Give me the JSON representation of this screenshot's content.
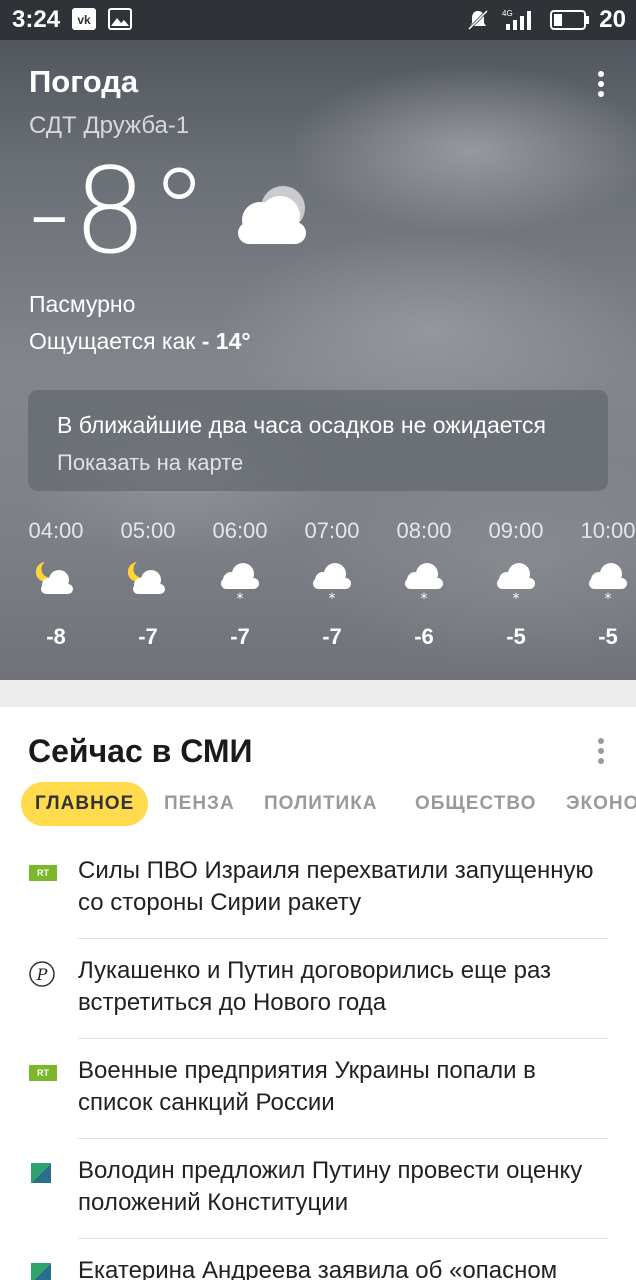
{
  "status_bar": {
    "time": "3:24",
    "network": "4G",
    "battery": "20"
  },
  "weather": {
    "title": "Погода",
    "location": "СДТ Дружба-1",
    "temperature": "-8°",
    "condition": "Пасмурно",
    "feels_like_label": "Ощущается как",
    "feels_like_value": "- 14°",
    "precip_text": "В ближайшие два часа осадков не ожидается",
    "precip_link": "Показать на карте",
    "hourly": [
      {
        "time": "04:00",
        "icon": "night-partly-cloudy-icon",
        "temp": "-8"
      },
      {
        "time": "05:00",
        "icon": "night-partly-cloudy-icon",
        "temp": "-7"
      },
      {
        "time": "06:00",
        "icon": "snow-cloud-icon",
        "temp": "-7"
      },
      {
        "time": "07:00",
        "icon": "snow-cloud-icon",
        "temp": "-7"
      },
      {
        "time": "08:00",
        "icon": "snow-cloud-icon",
        "temp": "-6"
      },
      {
        "time": "09:00",
        "icon": "snow-cloud-icon",
        "temp": "-5"
      },
      {
        "time": "10:00",
        "icon": "snow-cloud-icon",
        "temp": "-5"
      }
    ]
  },
  "news": {
    "title": "Сейчас в СМИ",
    "tabs": [
      "ГЛАВНОЕ",
      "ПЕНЗА",
      "ПОЛИТИКА",
      "ОБЩЕСТВО",
      "ЭКОНОМ"
    ],
    "active_tab": "ГЛАВНОЕ",
    "items": [
      {
        "source": "RT",
        "headline": "Силы ПВО Израиля перехватили запущенную со стороны Сирии ракету"
      },
      {
        "source": "Российская газета",
        "headline": "Лукашенко и Путин договорились еще раз встретиться до Нового года"
      },
      {
        "source": "RT",
        "headline": "Военные предприятия Украины попали в список санкций России"
      },
      {
        "source": "Парламентская газета",
        "headline": "Володин предложил Путину провести оценку положений Конституции"
      },
      {
        "source": "Парламентская газета",
        "headline": "Екатерина Андреева заявила об «опасном"
      }
    ]
  },
  "colors": {
    "accent": "#ffdb4d",
    "rt_green": "#7ab72a"
  }
}
